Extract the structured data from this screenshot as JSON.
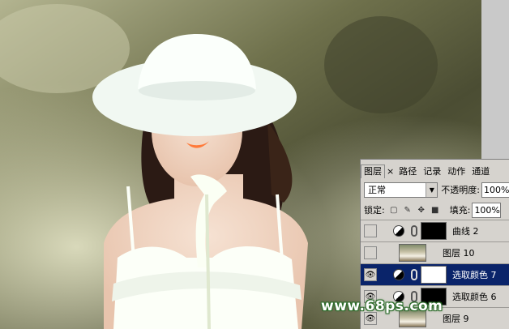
{
  "photo": {
    "subject": "woman-in-white-sun-hat",
    "colors": {
      "background_dark": "#4e5034",
      "background_light": "#b8b895",
      "hat": "#f5fbf6",
      "dress": "#fcfff8",
      "skin": "#f1d7c4",
      "hair": "#2b1a14"
    }
  },
  "layers_panel": {
    "tabs": [
      {
        "label": "图层",
        "active": true
      },
      {
        "label": "×",
        "active": false
      },
      {
        "label": "路径",
        "active": false
      },
      {
        "label": "记录",
        "active": false
      },
      {
        "label": "动作",
        "active": false
      },
      {
        "label": "通道",
        "active": false
      }
    ],
    "blend_mode": "正常",
    "opacity_label": "不透明度:",
    "opacity_value": "100%",
    "lock_label": "锁定:",
    "fill_label": "填充:",
    "fill_value": "100%",
    "layers": [
      {
        "name": "曲线 2",
        "type": "adjustment",
        "visible": false,
        "selected": false,
        "mask": "black"
      },
      {
        "name": "图层 10",
        "type": "bitmap",
        "visible": false,
        "selected": false
      },
      {
        "name": "选取颜色 7",
        "type": "adjustment",
        "visible": true,
        "selected": true,
        "mask": "white"
      },
      {
        "name": "选取颜色 6",
        "type": "adjustment",
        "visible": true,
        "selected": false,
        "mask": "black"
      },
      {
        "name": "图层 9",
        "type": "bitmap",
        "visible": true,
        "selected": false
      }
    ],
    "colors": {
      "panel_bg": "#d6d3ce",
      "selection": "#0a246a"
    }
  },
  "watermark": "www.68ps.com"
}
